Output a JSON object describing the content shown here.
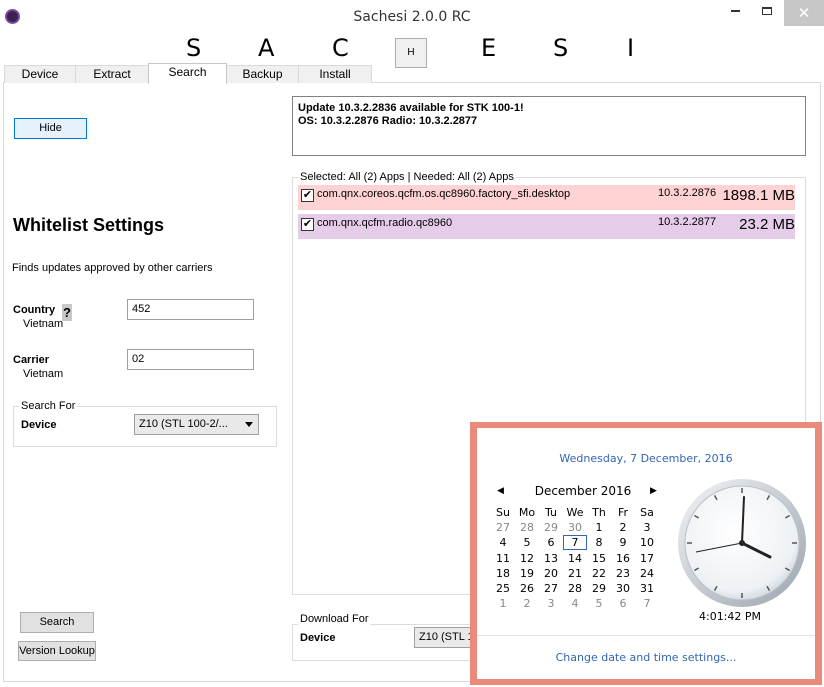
{
  "window": {
    "title": "Sachesi 2.0.0 RC",
    "minimize_icon": "minimize-icon",
    "maximize_icon": "maximize-icon",
    "close_label": "✕"
  },
  "header": {
    "letters": [
      "S",
      "A",
      "C",
      "E",
      "S",
      "I"
    ],
    "h_button": "H"
  },
  "tabs": [
    {
      "label": "Device"
    },
    {
      "label": "Extract"
    },
    {
      "label": "Search",
      "active": true
    },
    {
      "label": "Backup"
    },
    {
      "label": "Install"
    }
  ],
  "left": {
    "hide_button": "Hide",
    "section_title": "Whitelist Settings",
    "description": "Finds updates approved by other carriers",
    "country": {
      "label": "Country",
      "sub": "Vietnam",
      "value": "452",
      "help": "?"
    },
    "carrier": {
      "label": "Carrier",
      "sub": "Vietnam",
      "value": "02"
    },
    "search_for": {
      "legend": "Search For",
      "label": "Device",
      "value": "Z10 (STL 100-2/..."
    },
    "search_button": "Search",
    "version_lookup_button": "Version Lookup"
  },
  "right": {
    "update_line1": "Update 10.3.2.2836 available for STK 100-1!",
    "update_line2": "OS: 10.3.2.2876 Radio: 10.3.2.2877",
    "apps_legend": "Selected: All (2) Apps | Needed: All (2) Apps",
    "apps": [
      {
        "name": "com.qnx.coreos.qcfm.os.qc8960.factory_sfi.desktop",
        "version": "10.3.2.2876",
        "size": "1898.1 MB",
        "checked": true,
        "color": "#ffd3d3"
      },
      {
        "name": "com.qnx.qcfm.radio.qc8960",
        "version": "10.3.2.2877",
        "size": "23.2 MB",
        "checked": true,
        "color": "#e5cce8"
      }
    ],
    "download_for": {
      "legend": "Download For",
      "label": "Device",
      "value": "Z10 (STL 1"
    }
  },
  "clock_flyout": {
    "date_long": "Wednesday, 7 December, 2016",
    "month_label": "December 2016",
    "prev_icon": "◀",
    "next_icon": "▶",
    "weekdays": [
      "Su",
      "Mo",
      "Tu",
      "We",
      "Th",
      "Fr",
      "Sa"
    ],
    "weeks": [
      [
        "27",
        "28",
        "29",
        "30",
        "1",
        "2",
        "3"
      ],
      [
        "4",
        "5",
        "6",
        "7",
        "8",
        "9",
        "10"
      ],
      [
        "11",
        "12",
        "13",
        "14",
        "15",
        "16",
        "17"
      ],
      [
        "18",
        "19",
        "20",
        "21",
        "22",
        "23",
        "24"
      ],
      [
        "25",
        "26",
        "27",
        "28",
        "29",
        "30",
        "31"
      ],
      [
        "1",
        "2",
        "3",
        "4",
        "5",
        "6",
        "7"
      ]
    ],
    "today": "7",
    "time": "4:01:42 PM",
    "settings_link": "Change date and time settings...",
    "accent_color": "#3267b3",
    "border_color": "#ea8a7a"
  }
}
